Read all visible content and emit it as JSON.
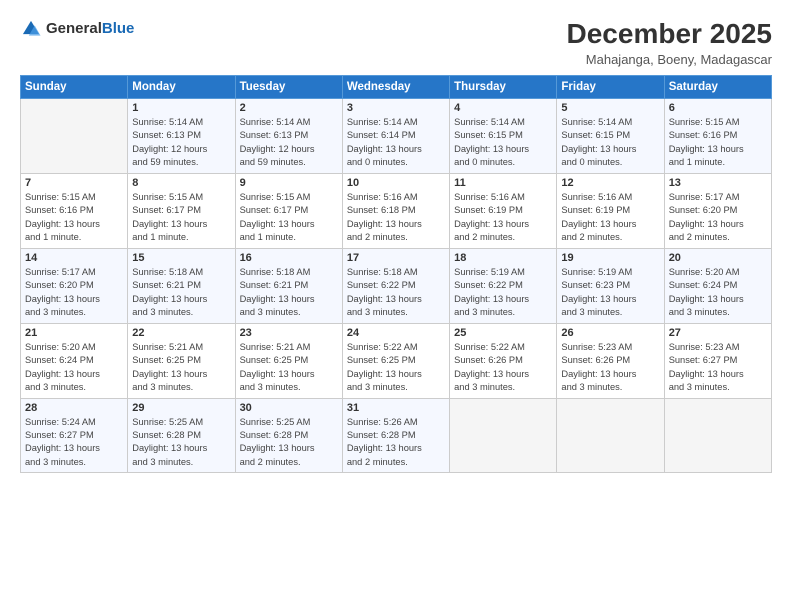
{
  "header": {
    "logo_general": "General",
    "logo_blue": "Blue",
    "title": "December 2025",
    "subtitle": "Mahajanga, Boeny, Madagascar"
  },
  "days_of_week": [
    "Sunday",
    "Monday",
    "Tuesday",
    "Wednesday",
    "Thursday",
    "Friday",
    "Saturday"
  ],
  "weeks": [
    [
      {
        "day": "",
        "info": ""
      },
      {
        "day": "1",
        "info": "Sunrise: 5:14 AM\nSunset: 6:13 PM\nDaylight: 12 hours\nand 59 minutes."
      },
      {
        "day": "2",
        "info": "Sunrise: 5:14 AM\nSunset: 6:13 PM\nDaylight: 12 hours\nand 59 minutes."
      },
      {
        "day": "3",
        "info": "Sunrise: 5:14 AM\nSunset: 6:14 PM\nDaylight: 13 hours\nand 0 minutes."
      },
      {
        "day": "4",
        "info": "Sunrise: 5:14 AM\nSunset: 6:15 PM\nDaylight: 13 hours\nand 0 minutes."
      },
      {
        "day": "5",
        "info": "Sunrise: 5:14 AM\nSunset: 6:15 PM\nDaylight: 13 hours\nand 0 minutes."
      },
      {
        "day": "6",
        "info": "Sunrise: 5:15 AM\nSunset: 6:16 PM\nDaylight: 13 hours\nand 1 minute."
      }
    ],
    [
      {
        "day": "7",
        "info": "Sunrise: 5:15 AM\nSunset: 6:16 PM\nDaylight: 13 hours\nand 1 minute."
      },
      {
        "day": "8",
        "info": "Sunrise: 5:15 AM\nSunset: 6:17 PM\nDaylight: 13 hours\nand 1 minute."
      },
      {
        "day": "9",
        "info": "Sunrise: 5:15 AM\nSunset: 6:17 PM\nDaylight: 13 hours\nand 1 minute."
      },
      {
        "day": "10",
        "info": "Sunrise: 5:16 AM\nSunset: 6:18 PM\nDaylight: 13 hours\nand 2 minutes."
      },
      {
        "day": "11",
        "info": "Sunrise: 5:16 AM\nSunset: 6:19 PM\nDaylight: 13 hours\nand 2 minutes."
      },
      {
        "day": "12",
        "info": "Sunrise: 5:16 AM\nSunset: 6:19 PM\nDaylight: 13 hours\nand 2 minutes."
      },
      {
        "day": "13",
        "info": "Sunrise: 5:17 AM\nSunset: 6:20 PM\nDaylight: 13 hours\nand 2 minutes."
      }
    ],
    [
      {
        "day": "14",
        "info": "Sunrise: 5:17 AM\nSunset: 6:20 PM\nDaylight: 13 hours\nand 3 minutes."
      },
      {
        "day": "15",
        "info": "Sunrise: 5:18 AM\nSunset: 6:21 PM\nDaylight: 13 hours\nand 3 minutes."
      },
      {
        "day": "16",
        "info": "Sunrise: 5:18 AM\nSunset: 6:21 PM\nDaylight: 13 hours\nand 3 minutes."
      },
      {
        "day": "17",
        "info": "Sunrise: 5:18 AM\nSunset: 6:22 PM\nDaylight: 13 hours\nand 3 minutes."
      },
      {
        "day": "18",
        "info": "Sunrise: 5:19 AM\nSunset: 6:22 PM\nDaylight: 13 hours\nand 3 minutes."
      },
      {
        "day": "19",
        "info": "Sunrise: 5:19 AM\nSunset: 6:23 PM\nDaylight: 13 hours\nand 3 minutes."
      },
      {
        "day": "20",
        "info": "Sunrise: 5:20 AM\nSunset: 6:24 PM\nDaylight: 13 hours\nand 3 minutes."
      }
    ],
    [
      {
        "day": "21",
        "info": "Sunrise: 5:20 AM\nSunset: 6:24 PM\nDaylight: 13 hours\nand 3 minutes."
      },
      {
        "day": "22",
        "info": "Sunrise: 5:21 AM\nSunset: 6:25 PM\nDaylight: 13 hours\nand 3 minutes."
      },
      {
        "day": "23",
        "info": "Sunrise: 5:21 AM\nSunset: 6:25 PM\nDaylight: 13 hours\nand 3 minutes."
      },
      {
        "day": "24",
        "info": "Sunrise: 5:22 AM\nSunset: 6:25 PM\nDaylight: 13 hours\nand 3 minutes."
      },
      {
        "day": "25",
        "info": "Sunrise: 5:22 AM\nSunset: 6:26 PM\nDaylight: 13 hours\nand 3 minutes."
      },
      {
        "day": "26",
        "info": "Sunrise: 5:23 AM\nSunset: 6:26 PM\nDaylight: 13 hours\nand 3 minutes."
      },
      {
        "day": "27",
        "info": "Sunrise: 5:23 AM\nSunset: 6:27 PM\nDaylight: 13 hours\nand 3 minutes."
      }
    ],
    [
      {
        "day": "28",
        "info": "Sunrise: 5:24 AM\nSunset: 6:27 PM\nDaylight: 13 hours\nand 3 minutes."
      },
      {
        "day": "29",
        "info": "Sunrise: 5:25 AM\nSunset: 6:28 PM\nDaylight: 13 hours\nand 3 minutes."
      },
      {
        "day": "30",
        "info": "Sunrise: 5:25 AM\nSunset: 6:28 PM\nDaylight: 13 hours\nand 2 minutes."
      },
      {
        "day": "31",
        "info": "Sunrise: 5:26 AM\nSunset: 6:28 PM\nDaylight: 13 hours\nand 2 minutes."
      },
      {
        "day": "",
        "info": ""
      },
      {
        "day": "",
        "info": ""
      },
      {
        "day": "",
        "info": ""
      }
    ]
  ]
}
